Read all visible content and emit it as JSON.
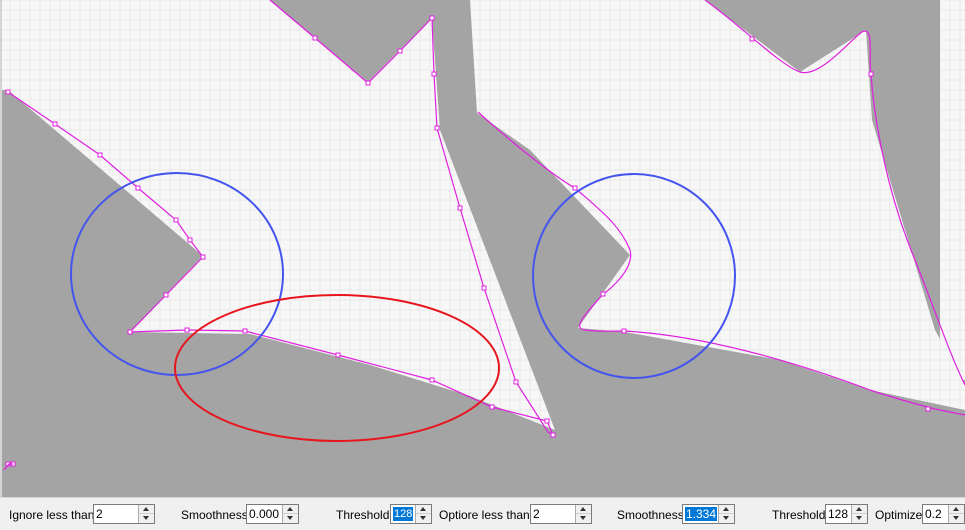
{
  "controls": {
    "left": {
      "ignore_label": "Ignore less than",
      "ignore_value": "2",
      "smoothness_label": "Smoothness",
      "smoothness_value": "0.000",
      "threshold_label": "Threshold",
      "threshold_value": "128"
    },
    "right": {
      "optiore_label": "Optiore less than",
      "optiore_value": "2",
      "smoothness_label": "Smoothness",
      "smoothness_value": "1.334",
      "threshold_label": "Threshold",
      "threshold_value": "128",
      "optimize_label": "Optimize",
      "optimize_value": "0.2"
    }
  },
  "colors": {
    "background_gray": "#a4a4a4",
    "shape_white": "#f7f7f7",
    "path_magenta": "#e020e0",
    "annotation_blue": "#4455ee",
    "annotation_red": "#e8141e",
    "selection_blue": "#0078d7"
  }
}
